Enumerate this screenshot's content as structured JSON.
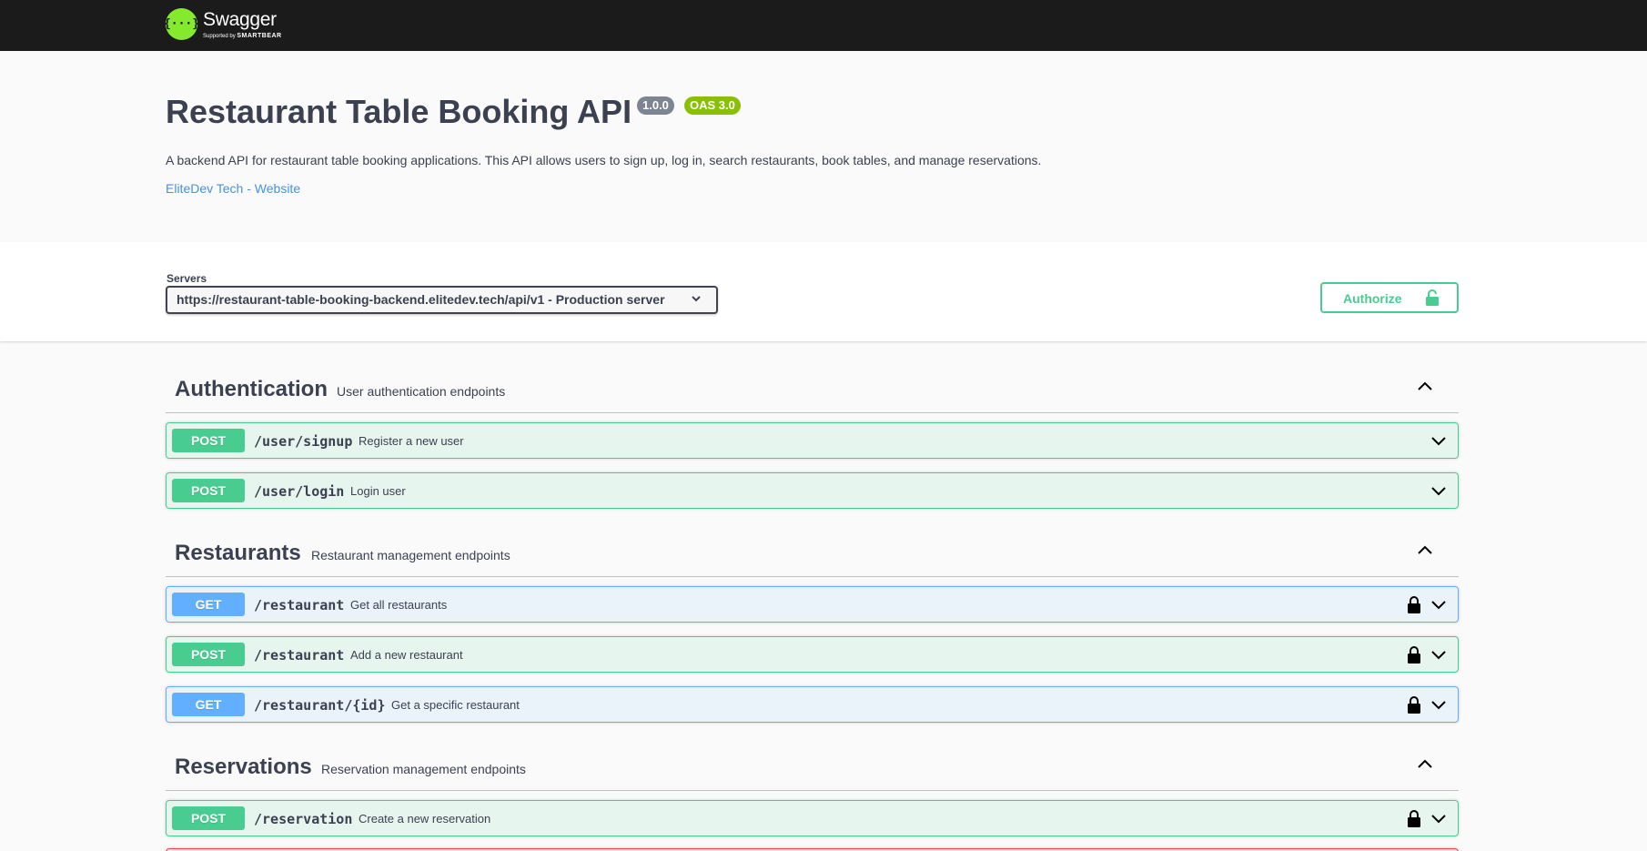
{
  "topbar": {
    "logo_glyph": "{···}",
    "brand": "Swagger",
    "supported_by": "Supported by",
    "sponsor": "SMARTBEAR"
  },
  "info": {
    "title": "Restaurant Table Booking API",
    "version": "1.0.0",
    "oas": "OAS 3.0",
    "description": "A backend API for restaurant table booking applications. This API allows users to sign up, log in, search restaurants, book tables, and manage reservations.",
    "link_text": "EliteDev Tech - Website"
  },
  "servers": {
    "label": "Servers",
    "selected": "https://restaurant-table-booking-backend.elitedev.tech/api/v1 - Production server"
  },
  "authorize": {
    "label": "Authorize",
    "icon": "unlock-icon"
  },
  "colors": {
    "post": "#49cc90",
    "get": "#61affe",
    "delete": "#f93e3e",
    "topbar": "#1b1b1b",
    "brand_green": "#85ea2d"
  },
  "tags": [
    {
      "name": "Authentication",
      "description": "User authentication endpoints",
      "operations": [
        {
          "method": "POST",
          "path": "/user/signup",
          "summary": "Register a new user",
          "locked": false
        },
        {
          "method": "POST",
          "path": "/user/login",
          "summary": "Login user",
          "locked": false
        }
      ]
    },
    {
      "name": "Restaurants",
      "description": "Restaurant management endpoints",
      "operations": [
        {
          "method": "GET",
          "path": "/restaurant",
          "summary": "Get all restaurants",
          "locked": true
        },
        {
          "method": "POST",
          "path": "/restaurant",
          "summary": "Add a new restaurant",
          "locked": true
        },
        {
          "method": "GET",
          "path": "/restaurant/{id}",
          "summary": "Get a specific restaurant",
          "locked": true
        }
      ]
    },
    {
      "name": "Reservations",
      "description": "Reservation management endpoints",
      "operations": [
        {
          "method": "POST",
          "path": "/reservation",
          "summary": "Create a new reservation",
          "locked": true
        }
      ]
    }
  ]
}
